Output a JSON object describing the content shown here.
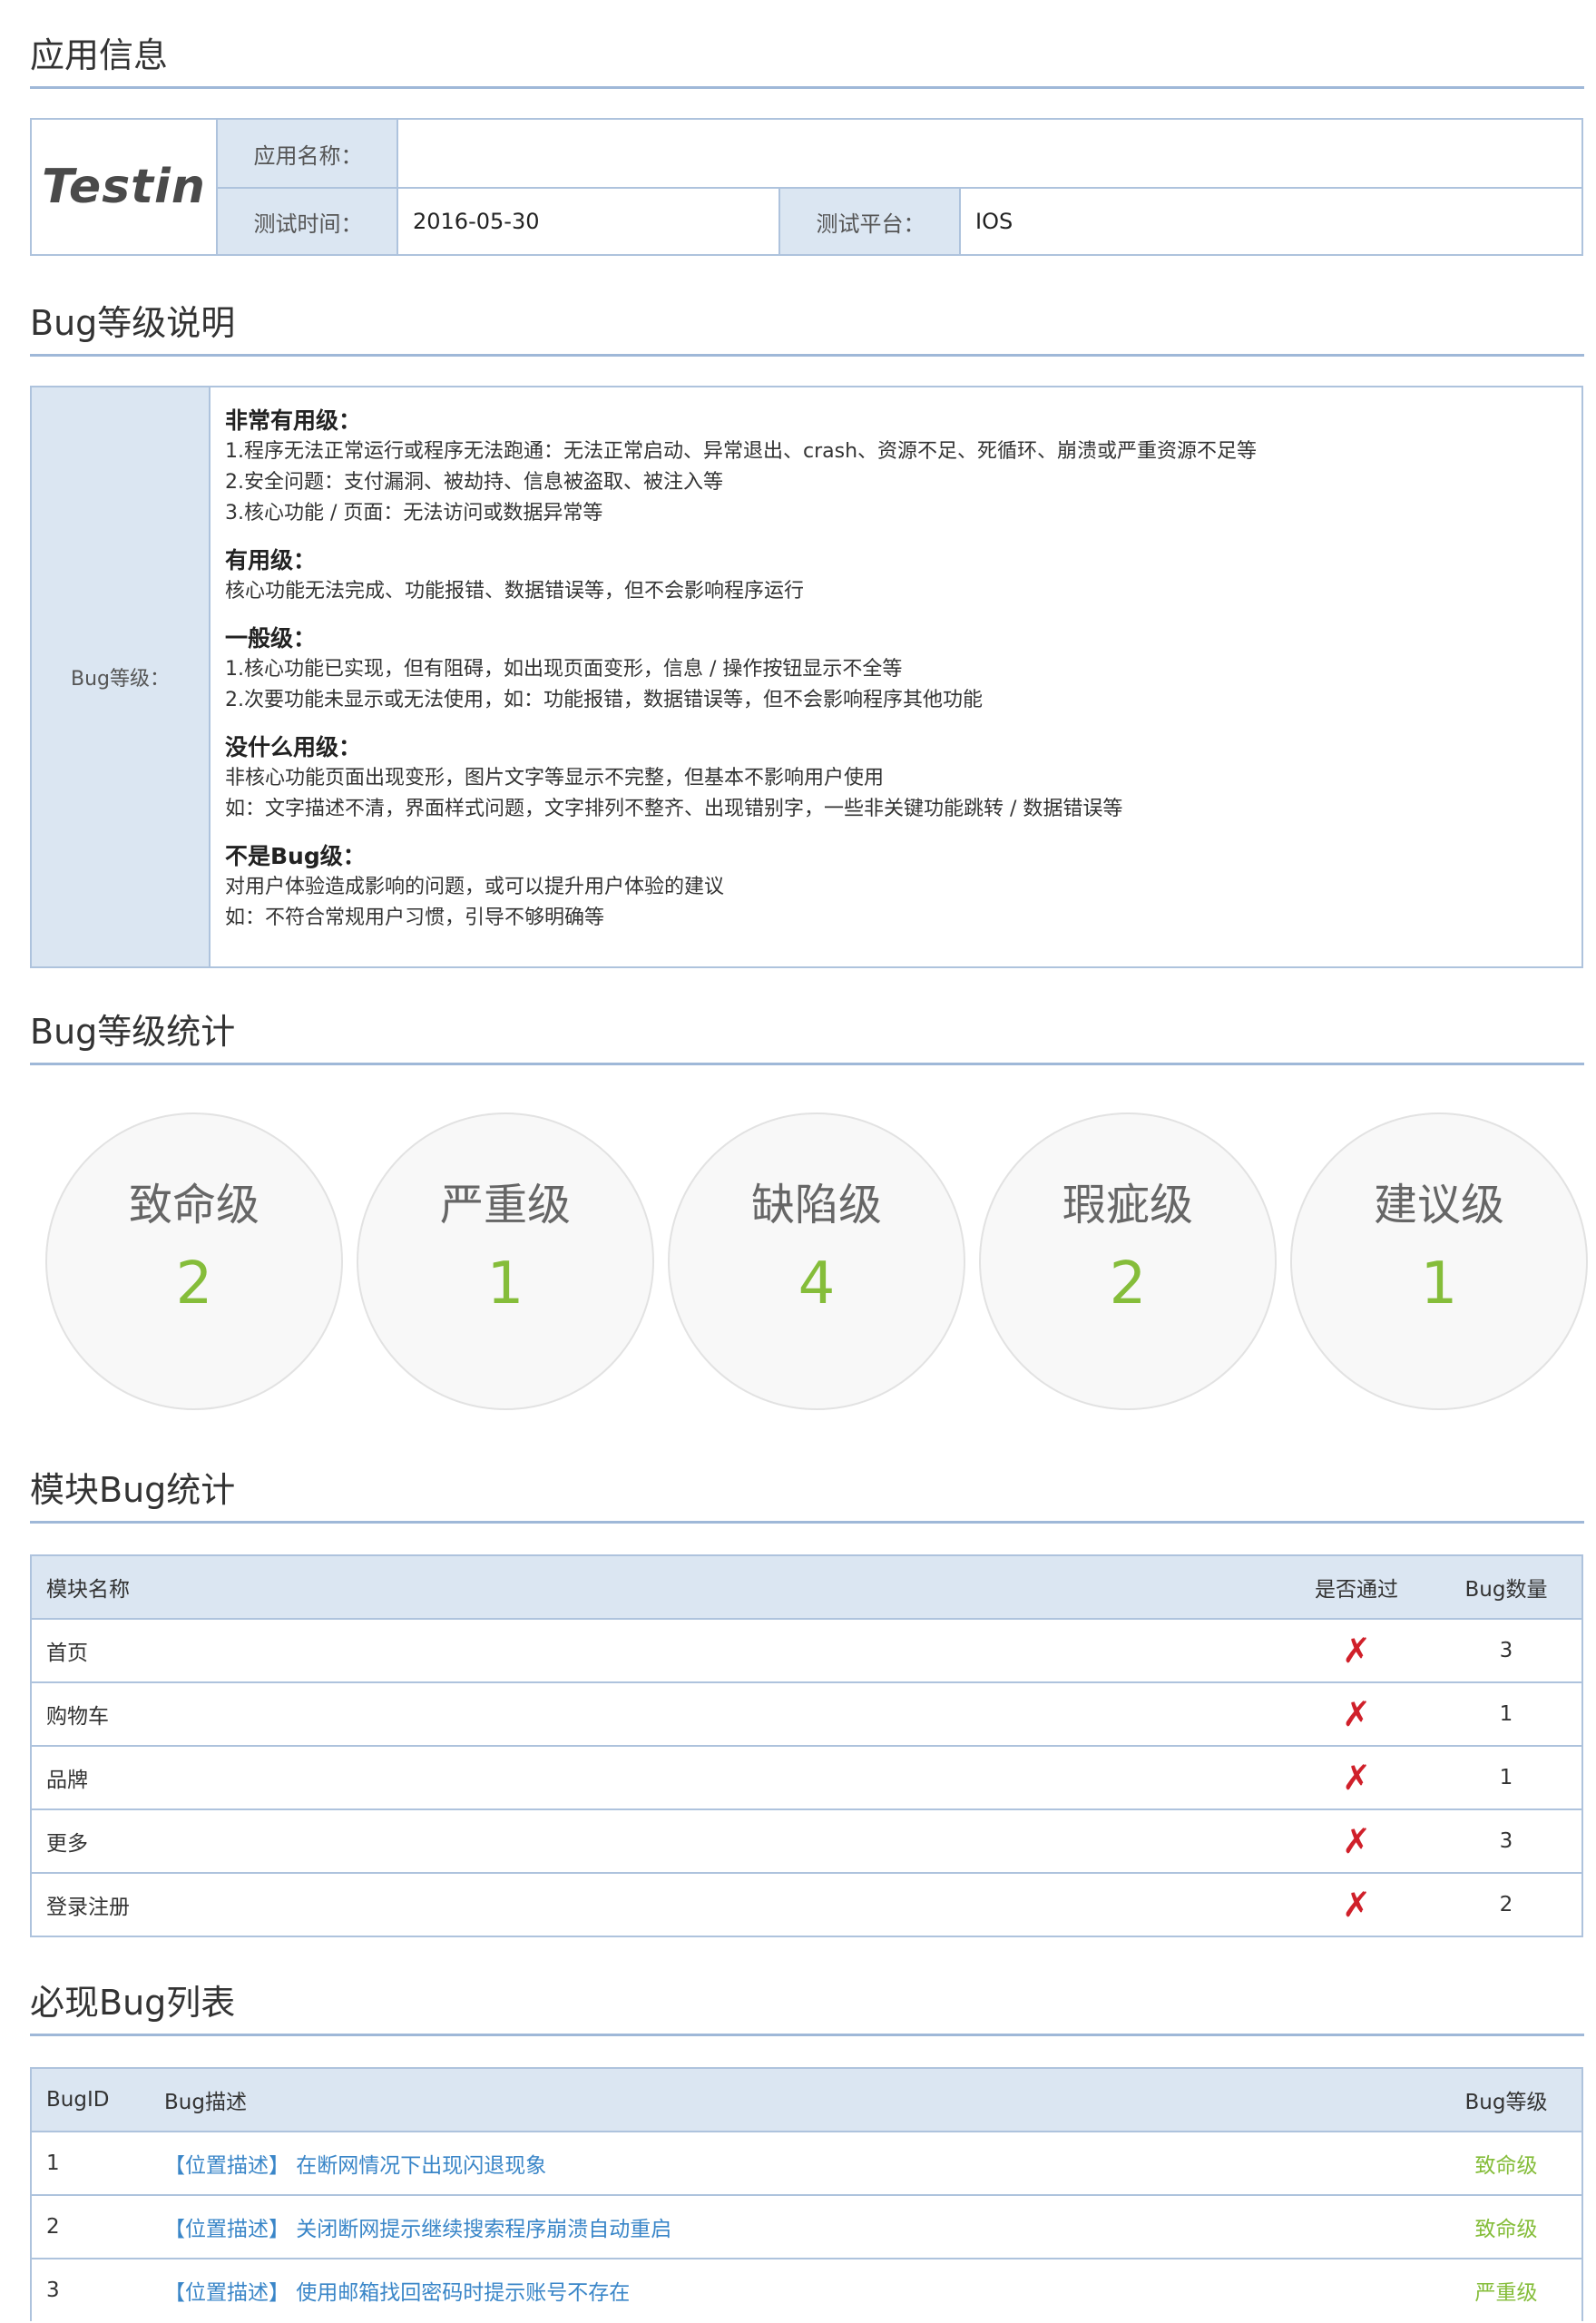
{
  "app_info": {
    "section_title": "应用信息",
    "logo_text": "Testin",
    "name_label": "应用名称：",
    "name_value": "",
    "time_label": "测试时间：",
    "time_value": "2016-05-30",
    "platform_label": "测试平台：",
    "platform_value": "IOS"
  },
  "bug_levels": {
    "section_title": "Bug等级说明",
    "row_label": "Bug等级：",
    "levels": [
      {
        "title": "非常有用级：",
        "lines": [
          "1.程序无法正常运行或程序无法跑通：无法正常启动、异常退出、crash、资源不足、死循环、崩溃或严重资源不足等",
          "2.安全问题：支付漏洞、被劫持、信息被盗取、被注入等",
          "3.核心功能 / 页面：无法访问或数据异常等"
        ]
      },
      {
        "title": "有用级：",
        "lines": [
          "核心功能无法完成、功能报错、数据错误等，但不会影响程序运行"
        ]
      },
      {
        "title": "一般级：",
        "lines": [
          "1.核心功能已实现，但有阻碍，如出现页面变形，信息 / 操作按钮显示不全等",
          "2.次要功能未显示或无法使用，如：功能报错，数据错误等，但不会影响程序其他功能"
        ]
      },
      {
        "title": "没什么用级：",
        "lines": [
          "非核心功能页面出现变形，图片文字等显示不完整，但基本不影响用户使用",
          "如：文字描述不清，界面样式问题，文字排列不整齐、出现错别字，一些非关键功能跳转 / 数据错误等"
        ]
      },
      {
        "title": "不是Bug级：",
        "lines": [
          "对用户体验造成影响的问题，或可以提升用户体验的建议",
          "如：不符合常规用户习惯，引导不够明确等"
        ]
      }
    ]
  },
  "bug_stats": {
    "section_title": "Bug等级统计",
    "items": [
      {
        "label": "致命级",
        "count": "2"
      },
      {
        "label": "严重级",
        "count": "1"
      },
      {
        "label": "缺陷级",
        "count": "4"
      },
      {
        "label": "瑕疵级",
        "count": "2"
      },
      {
        "label": "建议级",
        "count": "1"
      }
    ],
    "count_color": "#85bd3a"
  },
  "module_stats": {
    "section_title": "模块Bug统计",
    "headers": {
      "module": "模块名称",
      "pass": "是否通过",
      "count": "Bug数量"
    },
    "rows": [
      {
        "module": "首页",
        "pass_icon": "fail-cross-icon",
        "count": "3"
      },
      {
        "module": "购物车",
        "pass_icon": "fail-cross-icon",
        "count": "1"
      },
      {
        "module": "品牌",
        "pass_icon": "fail-cross-icon",
        "count": "1"
      },
      {
        "module": "更多",
        "pass_icon": "fail-cross-icon",
        "count": "3"
      },
      {
        "module": "登录注册",
        "pass_icon": "fail-cross-icon",
        "count": "2"
      }
    ]
  },
  "bug_list": {
    "section_title": "必现Bug列表",
    "headers": {
      "id": "BugID",
      "desc": "Bug描述",
      "level": "Bug等级"
    },
    "rows": [
      {
        "id": "1",
        "desc": "【位置描述】 在断网情况下出现闪退现象",
        "level": "致命级"
      },
      {
        "id": "2",
        "desc": "【位置描述】 关闭断网提示继续搜索程序崩溃自动重启",
        "level": "致命级"
      },
      {
        "id": "3",
        "desc": "【位置描述】 使用邮箱找回密码时提示账号不存在",
        "level": "严重级"
      }
    ],
    "link_color": "#3a86c8",
    "level_color": "#85bd3a"
  }
}
